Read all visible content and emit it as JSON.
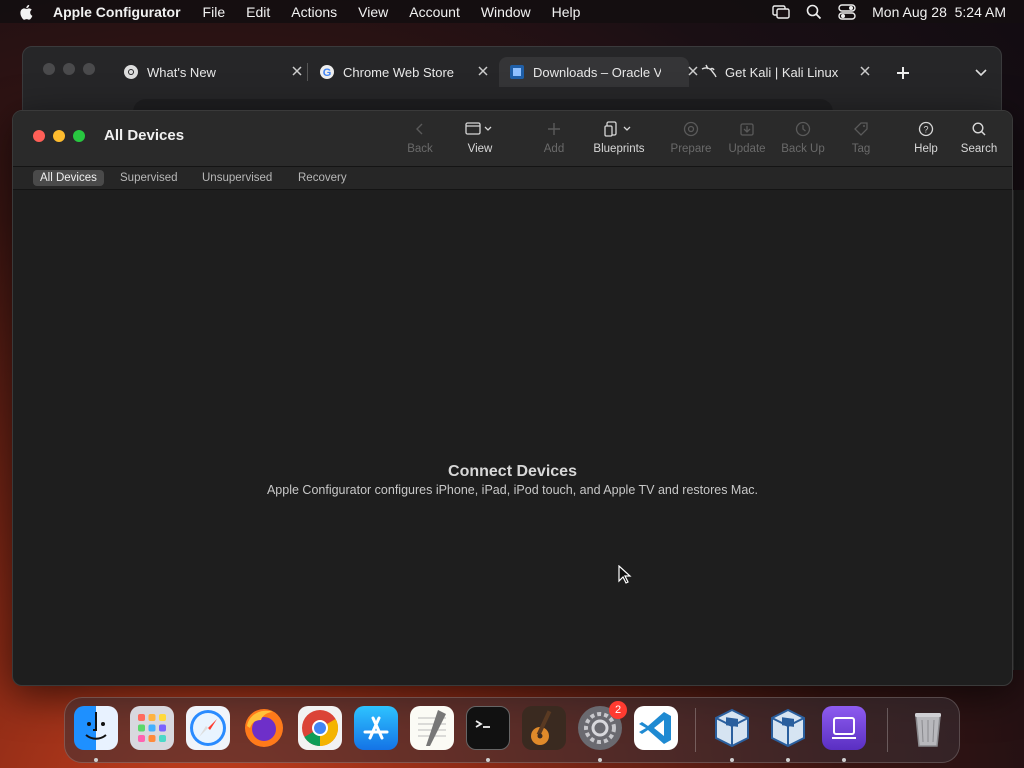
{
  "menubar": {
    "app_name": "Apple Configurator",
    "items": [
      "File",
      "Edit",
      "Actions",
      "View",
      "Account",
      "Window",
      "Help"
    ],
    "datetime": "Mon Aug 28  5:24 AM"
  },
  "browser": {
    "tabs": [
      {
        "label": "What's New",
        "icon": "chrome-icon"
      },
      {
        "label": "Chrome Web Store",
        "icon": "google-icon"
      },
      {
        "label": "Downloads – Oracle V",
        "icon": "virtualbox-icon"
      },
      {
        "label": "Get Kali | Kali Linux",
        "icon": "kali-icon"
      }
    ]
  },
  "window": {
    "title": "All Devices",
    "toolbar": {
      "back": "Back",
      "view": "View",
      "add": "Add",
      "blueprints": "Blueprints",
      "prepare": "Prepare",
      "update": "Update",
      "backup": "Back Up",
      "tag": "Tag",
      "help": "Help",
      "search": "Search"
    },
    "filters": [
      "All Devices",
      "Supervised",
      "Unsupervised",
      "Recovery"
    ],
    "empty_state": {
      "title": "Connect Devices",
      "subtitle": "Apple Configurator configures iPhone, iPad, iPod touch, and Apple TV and restores Mac."
    }
  },
  "dock": {
    "apps": [
      "finder-icon",
      "launchpad-icon",
      "safari-icon",
      "firefox-icon",
      "chrome-icon",
      "app-store-icon",
      "textedit-icon",
      "terminal-icon",
      "garageband-icon",
      "system-settings-icon",
      "vscode-icon",
      "virtualbox-icon",
      "virtualbox-vm-icon",
      "apple-configurator-icon",
      "trash-icon"
    ],
    "settings_badge": "2"
  }
}
